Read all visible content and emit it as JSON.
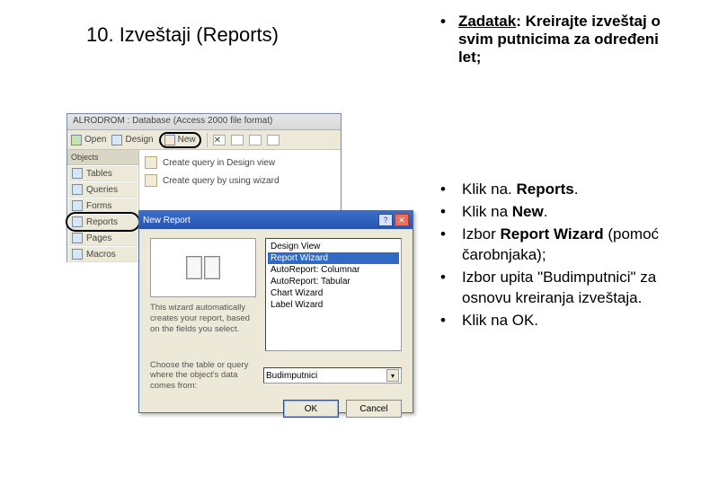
{
  "title": "10. Izveštaji (Reports)",
  "task": {
    "label": "Zadatak",
    "rest": ": Kreirajte izveštaj o svim putnicima za određeni let;"
  },
  "steps": [
    {
      "pre": "Klik na. ",
      "bold": "Reports",
      "post": "."
    },
    {
      "pre": "Klik na ",
      "bold": "New",
      "post": "."
    },
    {
      "pre": "Izbor ",
      "bold": "Report Wizard",
      "post": " (pomoć čarobnjaka);"
    },
    {
      "pre": "Izbor upita \"Budimputnici\" za osnovu kreiranja izveštaja.",
      "bold": "",
      "post": ""
    },
    {
      "pre": "Klik na OK.",
      "bold": "",
      "post": ""
    }
  ],
  "access": {
    "title": "ALRODROM : Database (Access 2000 file format)",
    "toolbar": {
      "open": "Open",
      "design": "Design",
      "new": "New"
    },
    "side_head": "Objects",
    "side_items": [
      "Tables",
      "Queries",
      "Forms",
      "Reports",
      "Pages",
      "Macros"
    ],
    "main_item1": "Create query in Design view",
    "main_item2": "Create query by using wizard"
  },
  "dialog": {
    "title": "New Report",
    "wizard_desc": "This wizard automatically creates your report, based on the fields you select.",
    "options": [
      "Design View",
      "Report Wizard",
      "AutoReport: Columnar",
      "AutoReport: Tabular",
      "Chart Wizard",
      "Label Wizard"
    ],
    "src_label": "Choose the table or query where the object's data comes from:",
    "combo_value": "Budimputnici",
    "ok": "OK",
    "cancel": "Cancel"
  }
}
